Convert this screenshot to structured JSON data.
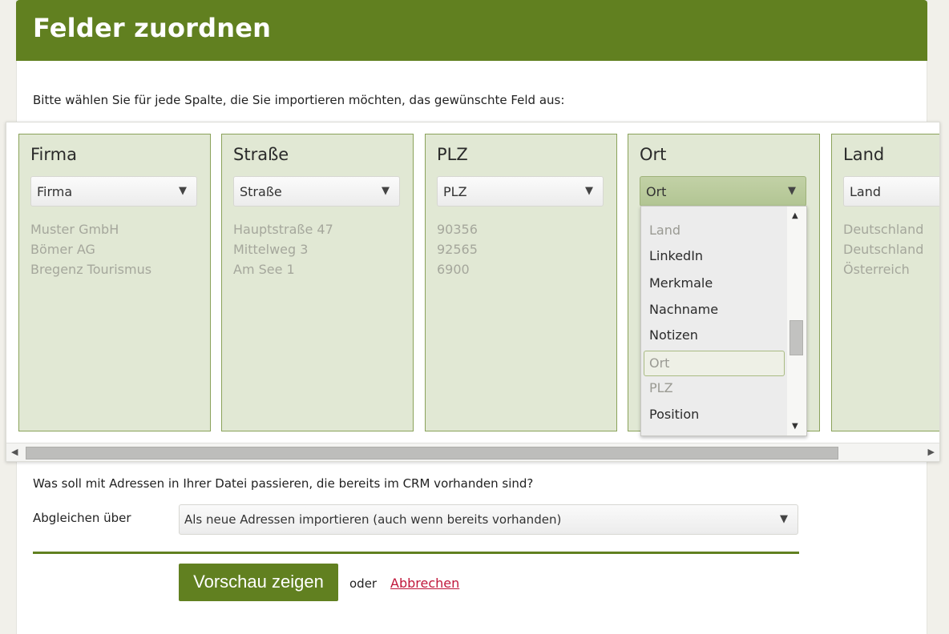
{
  "header": {
    "title": "Felder zuordnen"
  },
  "intro": "Bitte wählen Sie für jede Spalte, die Sie importieren möchten, das gewünschte Feld aus:",
  "columns": [
    {
      "title": "Firma",
      "selected": "Firma",
      "samples": [
        "Muster GmbH",
        "Bömer AG",
        "Bregenz Tourismus"
      ]
    },
    {
      "title": "Straße",
      "selected": "Straße",
      "samples": [
        "Hauptstraße 47",
        "Mittelweg 3",
        "Am See 1"
      ]
    },
    {
      "title": "PLZ",
      "selected": "PLZ",
      "samples": [
        "90356",
        "92565",
        "6900"
      ]
    },
    {
      "title": "Ort",
      "selected": "Ort",
      "samples": []
    },
    {
      "title": "Land",
      "selected": "Land",
      "samples": [
        "Deutschland",
        "Deutschland",
        "Österreich"
      ]
    }
  ],
  "dropdown": {
    "options": [
      "Land",
      "LinkedIn",
      "Merkmale",
      "Nachname",
      "Notizen",
      "Ort",
      "PLZ",
      "Position"
    ],
    "selected_option": "Ort"
  },
  "arrow_glyph": "▼",
  "question": "Was soll mit Adressen in Ihrer Datei passieren, die bereits im CRM vorhanden sind?",
  "match": {
    "label": "Abgleichen über",
    "value": "Als neue Adressen importieren (auch wenn bereits vorhanden)"
  },
  "actions": {
    "preview_label": "Vorschau zeigen",
    "or_text": "oder",
    "cancel_label": "Abbrechen"
  },
  "colors": {
    "brand_green": "#618020",
    "column_bg": "#e1e8d4",
    "cancel_red": "#c0163a"
  }
}
